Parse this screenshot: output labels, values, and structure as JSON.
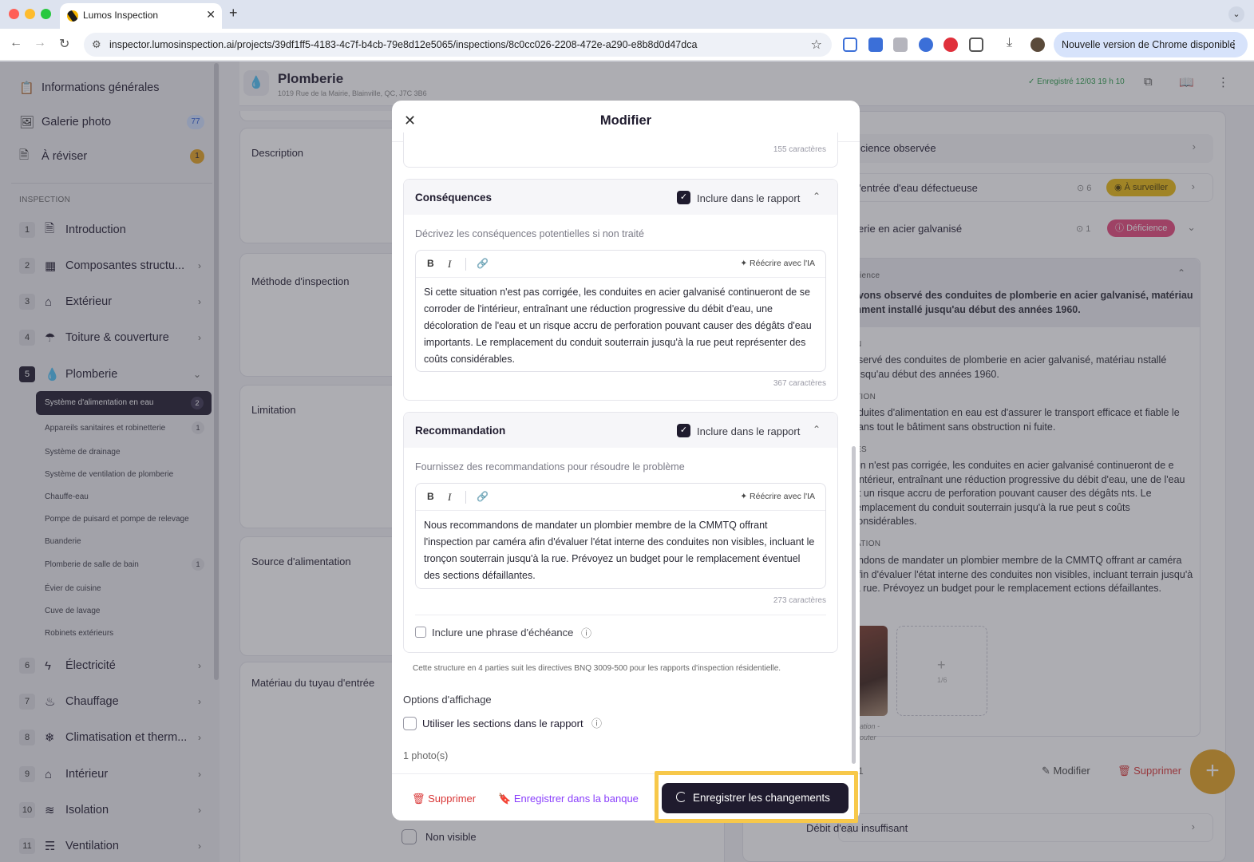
{
  "browser": {
    "tab_title": "Lumos Inspection",
    "url": "inspector.lumosinspection.ai/projects/39df1ff5-4183-4c7f-b4cb-79e8d12e5065/inspections/8c0cc026-2208-472e-a290-e8b8d0d47dca",
    "update_label": "Nouvelle version de Chrome disponible"
  },
  "sidebar": {
    "top_items": [
      {
        "label": "Informations générales",
        "icon": "clipboard-icon"
      },
      {
        "label": "Galerie photo",
        "icon": "photo-gallery-icon",
        "badge": "77"
      },
      {
        "label": "À réviser",
        "icon": "review-icon",
        "badge": "1"
      }
    ],
    "heading": "INSPECTION",
    "sections": [
      {
        "num": "1",
        "label": "Introduction",
        "icon": "document-icon"
      },
      {
        "num": "2",
        "label": "Composantes structu...",
        "icon": "building-icon"
      },
      {
        "num": "3",
        "label": "Extérieur",
        "icon": "house-icon"
      },
      {
        "num": "4",
        "label": "Toiture & couverture",
        "icon": "umbrella-icon"
      },
      {
        "num": "5",
        "label": "Plomberie",
        "icon": "water-drop-icon"
      },
      {
        "num": "6",
        "label": "Électricité",
        "icon": "lightning-icon"
      },
      {
        "num": "7",
        "label": "Chauffage",
        "icon": "flame-icon"
      },
      {
        "num": "8",
        "label": "Climatisation et therm...",
        "icon": "snowflake-icon"
      },
      {
        "num": "9",
        "label": "Intérieur",
        "icon": "house-icon"
      },
      {
        "num": "10",
        "label": "Isolation",
        "icon": "layers-icon"
      },
      {
        "num": "11",
        "label": "Ventilation",
        "icon": "wind-icon"
      }
    ],
    "plumbing_subitems": [
      {
        "label": "Système d'alimentation en eau",
        "badge": "2",
        "active": true
      },
      {
        "label": "Appareils sanitaires et robinetterie",
        "badge": "1"
      },
      {
        "label": "Système de drainage"
      },
      {
        "label": "Système de ventilation de plomberie"
      },
      {
        "label": "Chauffe-eau"
      },
      {
        "label": "Pompe de puisard et pompe de relevage"
      },
      {
        "label": "Buanderie"
      },
      {
        "label": "Plomberie de salle de bain",
        "badge": "1"
      },
      {
        "label": "Évier de cuisine"
      },
      {
        "label": "Cuve de lavage"
      },
      {
        "label": "Robinets extérieurs"
      }
    ]
  },
  "page": {
    "title": "Plomberie",
    "address": "1019 Rue de la Mairie, Blainville, QC, J7C 3B6",
    "saved_status": "Enregistré 12/03 19 h 10",
    "field_labels": [
      "Description",
      "Méthode d'inspection",
      "Limitation",
      "Source d'alimentation",
      "Matériau du tuyau d'entrée"
    ],
    "non_visible_label": "Non visible"
  },
  "right_panel": {
    "row1": "icience observée",
    "row2": "'entrée d'eau défectueuse",
    "row2_count": "6",
    "row2_badge": "À surveiller",
    "row3": "erie en acier galvanisé",
    "row3_count": "1",
    "row3_badge": "Déficience",
    "expanded_head": "ience",
    "expanded_summary": "avons observé des conduites de plomberie en acier galvanisé, matériau mment installé jusqu'au début des années 1960.",
    "h1": "N",
    "p1": "bservé des conduites de plomberie en acier galvanisé, matériau nstallé jusqu'au début des années 1960.",
    "h2": "TION",
    "p2": "nduites d'alimentation en eau est d'assurer le transport efficace et fiable le dans tout le bâtiment sans obstruction ni fuite.",
    "h3": "ES",
    "p3": "ion n'est pas corrigée, les conduites en acier galvanisé continueront de e l'intérieur, entraînant une réduction progressive du débit d'eau, une de l'eau et un risque accru de perforation pouvant causer des dégâts nts. Le remplacement du conduit souterrain jusqu'à la rue peut s coûts considérables.",
    "h4": "ATION",
    "p4": "andons de mandater un plombier membre de la CMMTQ offrant ar caméra afin d'évaluer l'état interne des conduites non visibles, incluant terrain jusqu'à la rue. Prévoyez un budget pour le remplacement ections défaillantes.",
    "photo_caption": "ation - outer",
    "add_count": "1/6",
    "row_count": "1",
    "edit": "Modifier",
    "delete": "Supprimer",
    "row4": "Débit d'eau insuffisant"
  },
  "modal": {
    "title": "Modifier",
    "top_count": "155 caractères",
    "consequences": {
      "title": "Conséquences",
      "include_label": "Inclure dans le rapport",
      "hint": "Décrivez les conséquences potentielles si non traité",
      "ai_label": "Réécrire avec l'IA",
      "text": "Si cette situation n'est pas corrigée, les conduites en acier galvanisé continueront de se corroder de l'intérieur, entraînant une réduction progressive du débit d'eau, une décoloration de l'eau et un risque accru de perforation pouvant causer des dégâts d'eau importants. Le remplacement du conduit souterrain jusqu'à la rue peut représenter des coûts considérables.",
      "count": "367 caractères"
    },
    "recommendation": {
      "title": "Recommandation",
      "include_label": "Inclure dans le rapport",
      "hint": "Fournissez des recommandations pour résoudre le problème",
      "ai_label": "Réécrire avec l'IA",
      "text": "Nous recommandons de mandater un plombier membre de la CMMTQ offrant l'inspection par caméra afin d'évaluer l'état interne des conduites non visibles, incluant le tronçon souterrain jusqu'à la rue. Prévoyez un budget pour le remplacement éventuel des sections défaillantes.",
      "count": "273 caractères",
      "deadline_label": "Inclure une phrase d'échéance"
    },
    "footnote": "Cette structure en 4 parties suit les directives BNQ 3009-500 pour les rapports d'inspection résidentielle.",
    "display_options_title": "Options d'affichage",
    "use_sections_label": "Utiliser les sections dans le rapport",
    "photo_count": "1 photo(s)",
    "footer": {
      "delete": "Supprimer",
      "save_bank": "Enregistrer dans la banque",
      "save_changes": "Enregistrer les changements"
    }
  },
  "colors": {
    "primary_dark": "#1f1b2e",
    "danger": "#d93636",
    "accent_purple": "#8a3ffc",
    "warning": "#e4a320",
    "highlight": "#f7c84a"
  }
}
